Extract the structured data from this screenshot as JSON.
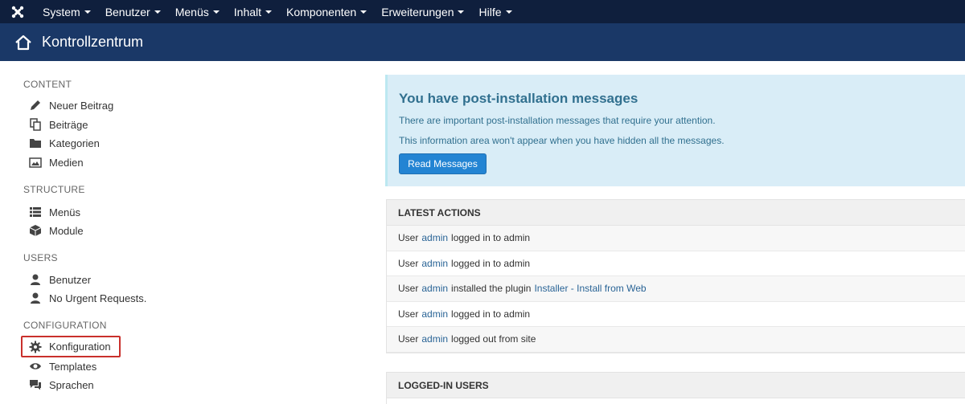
{
  "navbar": {
    "brand_icon": "joomla-logo-icon",
    "items": [
      {
        "label": "System"
      },
      {
        "label": "Benutzer"
      },
      {
        "label": "Menüs"
      },
      {
        "label": "Inhalt"
      },
      {
        "label": "Komponenten"
      },
      {
        "label": "Erweiterungen"
      },
      {
        "label": "Hilfe"
      }
    ]
  },
  "subhead": {
    "icon": "home-icon",
    "title": "Kontrollzentrum"
  },
  "sidebar": {
    "content": {
      "title": "CONTENT",
      "items": [
        {
          "label": "Neuer Beitrag",
          "icon": "pencil-icon"
        },
        {
          "label": "Beiträge",
          "icon": "copy-icon"
        },
        {
          "label": "Kategorien",
          "icon": "folder-icon"
        },
        {
          "label": "Medien",
          "icon": "image-icon"
        }
      ]
    },
    "structure": {
      "title": "STRUCTURE",
      "items": [
        {
          "label": "Menüs",
          "icon": "list-icon"
        },
        {
          "label": "Module",
          "icon": "cube-icon"
        }
      ]
    },
    "users": {
      "title": "USERS",
      "items": [
        {
          "label": "Benutzer",
          "icon": "user-icon"
        },
        {
          "label": "No Urgent Requests.",
          "icon": "user-icon"
        }
      ]
    },
    "configuration": {
      "title": "CONFIGURATION",
      "items": [
        {
          "label": "Konfiguration",
          "icon": "gear-icon"
        },
        {
          "label": "Templates",
          "icon": "eye-icon"
        },
        {
          "label": "Sprachen",
          "icon": "comments-icon"
        }
      ]
    }
  },
  "alert": {
    "title": "You have post-installation messages",
    "line1": "There are important post-installation messages that require your attention.",
    "line2": "This information area won't appear when you have hidden all the messages.",
    "button": "Read Messages"
  },
  "latest_actions": {
    "title": "LATEST ACTIONS",
    "rows": [
      {
        "pre": "User",
        "user": "admin",
        "post": "logged in to admin",
        "link2": ""
      },
      {
        "pre": "User",
        "user": "admin",
        "post": "logged in to admin",
        "link2": ""
      },
      {
        "pre": "User",
        "user": "admin",
        "post": "installed the plugin",
        "link2": "Installer - Install from Web"
      },
      {
        "pre": "User",
        "user": "admin",
        "post": "logged in to admin",
        "link2": ""
      },
      {
        "pre": "User",
        "user": "admin",
        "post": "logged out from site",
        "link2": ""
      }
    ]
  },
  "logged_in_users": {
    "title": "LOGGED-IN USERS"
  },
  "colors": {
    "navbar": "#0f1f3d",
    "subhead": "#1a3867",
    "alert_bg": "#d9edf7",
    "alert_text": "#31708f",
    "button": "#2384d3",
    "link": "#2a6496",
    "highlight": "#c9302c"
  }
}
